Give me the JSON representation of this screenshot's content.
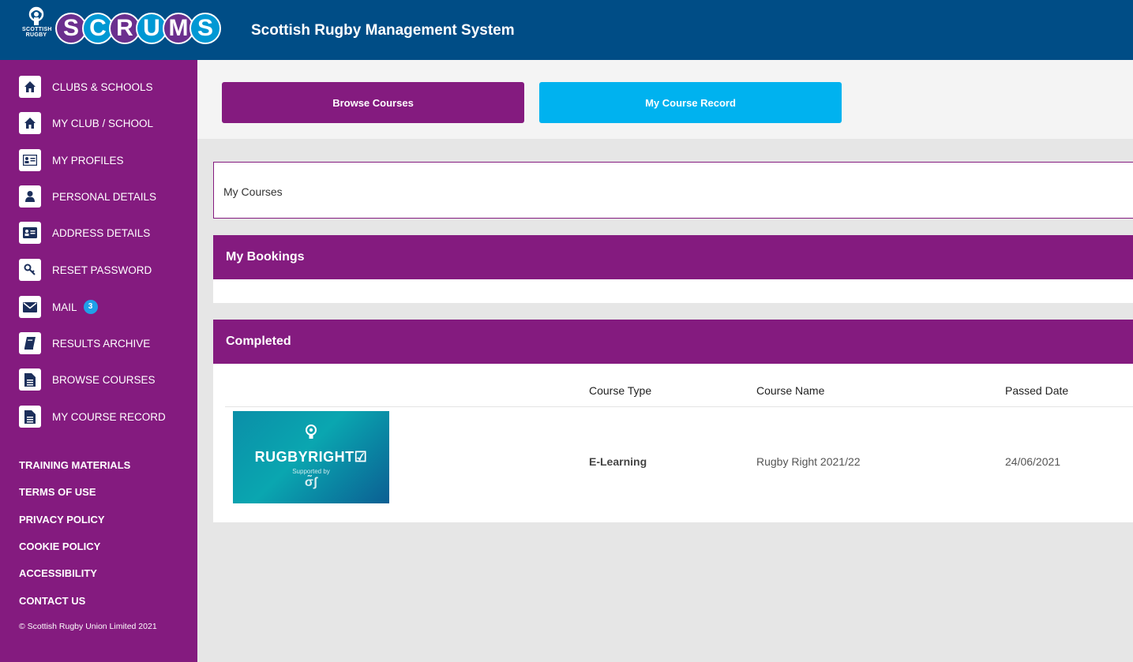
{
  "header": {
    "crest_text_1": "SCOTTISH",
    "crest_text_2": "RUGBY",
    "logo_letters": [
      "S",
      "C",
      "R",
      "U",
      "M",
      "S"
    ],
    "title": "Scottish Rugby Management System",
    "colors": {
      "bar": "#004d86",
      "purple": "#841b7f",
      "cyan": "#00b2ef"
    }
  },
  "sidebar": {
    "items": [
      {
        "label": "CLUBS & SCHOOLS",
        "icon": "home-icon"
      },
      {
        "label": "MY CLUB / SCHOOL",
        "icon": "home-icon"
      },
      {
        "label": "MY PROFILES",
        "icon": "id-card-icon"
      },
      {
        "label": "PERSONAL DETAILS",
        "icon": "user-icon"
      },
      {
        "label": "ADDRESS DETAILS",
        "icon": "address-card-icon"
      },
      {
        "label": "RESET PASSWORD",
        "icon": "key-icon"
      },
      {
        "label": "MAIL",
        "icon": "envelope-icon",
        "badge": "3"
      },
      {
        "label": "RESULTS ARCHIVE",
        "icon": "book-icon"
      },
      {
        "label": "BROWSE COURSES",
        "icon": "file-icon"
      },
      {
        "label": "MY COURSE RECORD",
        "icon": "file-icon"
      }
    ],
    "footer_links": [
      "TRAINING MATERIALS",
      "TERMS OF USE",
      "PRIVACY POLICY",
      "COOKIE POLICY",
      "ACCESSIBILITY",
      "CONTACT US"
    ],
    "copyright": "© Scottish Rugby Union Limited 2021"
  },
  "buttons": {
    "browse": "Browse Courses",
    "record": "My Course Record"
  },
  "my_courses_label": "My Courses",
  "bookings": {
    "title": "My Bookings"
  },
  "completed": {
    "title": "Completed",
    "columns": [
      "Course Type",
      "Course Name",
      "Passed Date"
    ],
    "rows": [
      {
        "thumb_brand": "RUGBYRIGHT☑",
        "thumb_sub": "Supported by",
        "thumb_mark": "σ̃ʃ",
        "course_type": "E-Learning",
        "course_name": "Rugby Right 2021/22",
        "passed_date": "24/06/2021"
      }
    ]
  }
}
